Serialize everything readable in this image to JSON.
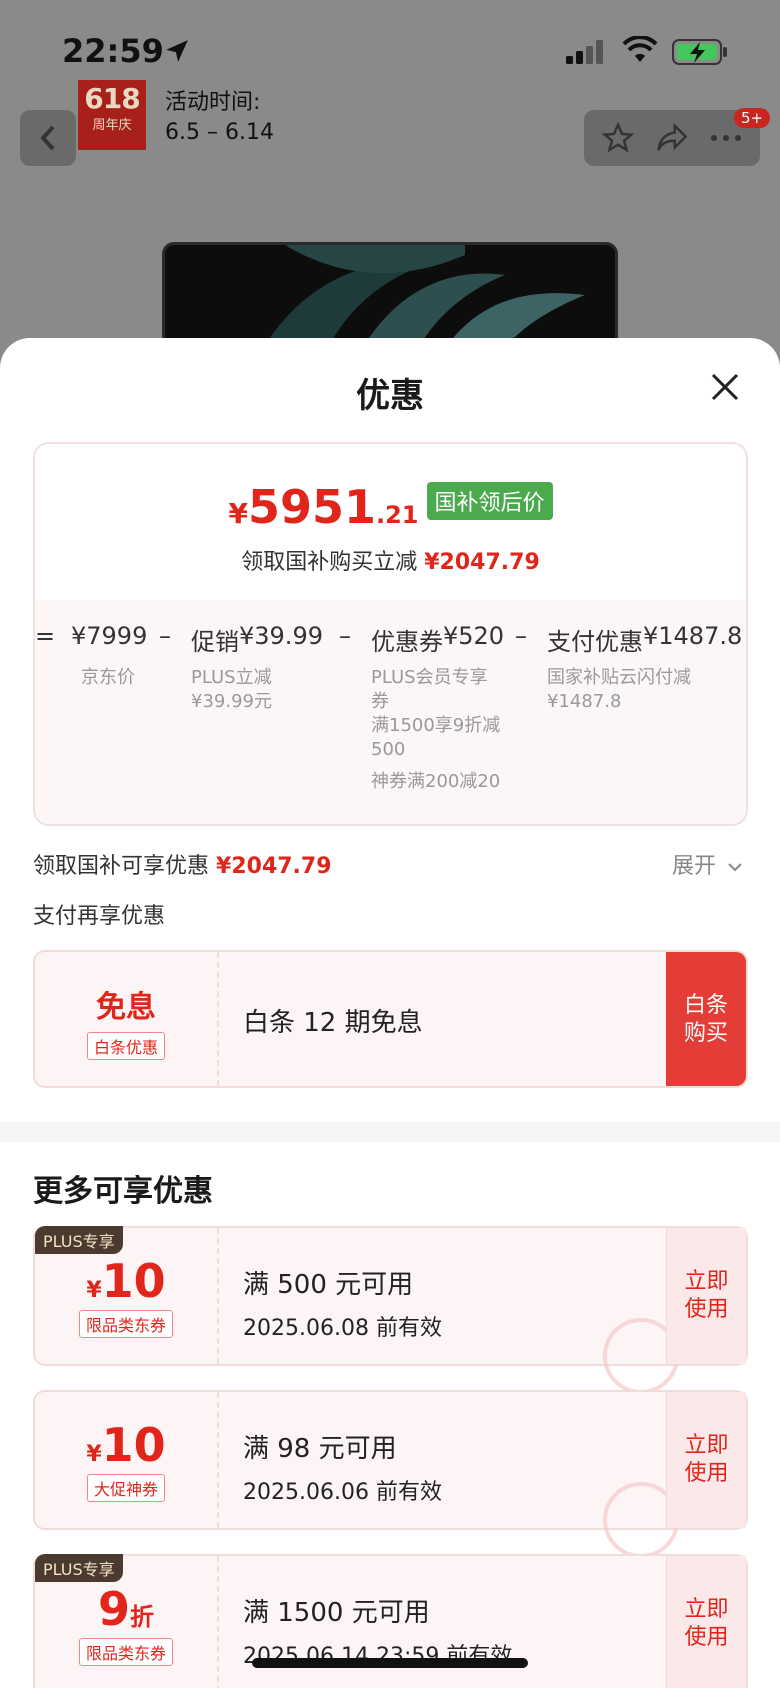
{
  "status_bar": {
    "time": "22:59"
  },
  "header": {
    "logo_number": "618",
    "logo_sub": "周年庆",
    "activity_label": "活动时间:",
    "activity_range": "6.5 – 6.14",
    "badge": "5+"
  },
  "sheet": {
    "title": "优惠",
    "price_card": {
      "currency": "¥",
      "price_int": "5951",
      "price_dec": ".21",
      "tag": "国补领后价",
      "subline_text": "领取国补购买立减",
      "subline_amount": "¥2047.79",
      "calc": {
        "eq": "=",
        "jd_price": "¥7999",
        "minus1": "–",
        "promo_label": "促销",
        "promo_value": "¥39.99",
        "minus2": "–",
        "coupon_label": "优惠券",
        "coupon_value": "¥520",
        "minus3": "–",
        "pay_label": "支付优惠",
        "pay_value": "¥1487.8"
      },
      "subs": {
        "jd_price": "京东价",
        "promo": "PLUS立减\n¥39.99元",
        "coupon1": "PLUS会员专享\n券",
        "coupon2": "满1500享9折减\n500",
        "coupon3": "神券满200减20",
        "pay": "国家补贴云闪付减\n¥1487.8"
      }
    },
    "nat_sub_label": "领取国补可享优惠",
    "nat_sub_amount": "¥2047.79",
    "expand": "展开",
    "pay_more_label": "支付再享优惠",
    "baitiao": {
      "title": "免息",
      "tag": "白条优惠",
      "desc": "白条 12 期免息",
      "button": "白条\n购买"
    },
    "more_title": "更多可享优惠",
    "coupons": [
      {
        "plus": "PLUS专享",
        "yen": "¥",
        "value": "10",
        "unit": "",
        "tag": "限品类东券",
        "cond": "满 500 元可用",
        "valid": "2025.06.08 前有效",
        "button": "立即\n使用"
      },
      {
        "plus": "",
        "yen": "¥",
        "value": "10",
        "unit": "",
        "tag": "大促神券",
        "cond": "满 98 元可用",
        "valid": "2025.06.06 前有效",
        "button": "立即\n使用"
      },
      {
        "plus": "PLUS专享",
        "yen": "",
        "value": "9",
        "unit": "折",
        "tag": "限品类东券",
        "cond": "满 1500 元可用",
        "valid": "2025.06.14 23:59 前有效",
        "button": "立即\n使用"
      }
    ]
  },
  "colors": {
    "accent": "#e1251b",
    "green_tag": "#4caa4e",
    "plus_tag": "#4a3b2e"
  }
}
